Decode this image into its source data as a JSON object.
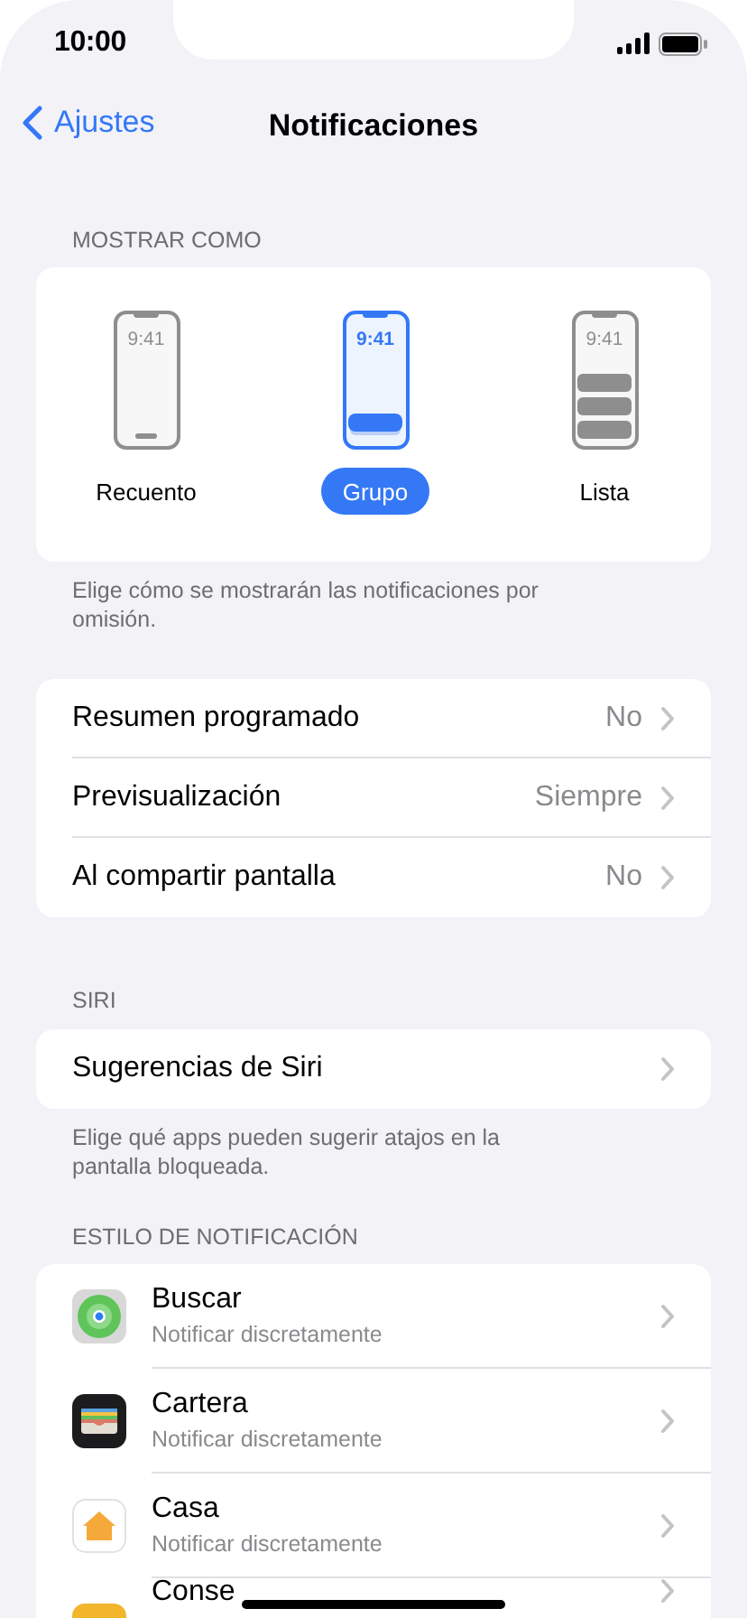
{
  "status_bar": {
    "time": "10:00"
  },
  "nav": {
    "back": "Ajustes",
    "title": "Notificaciones"
  },
  "display_section": {
    "header": "MOSTRAR COMO",
    "options": [
      {
        "label": "Recuento",
        "kind": "count",
        "selected": false,
        "screen_time": "9:41"
      },
      {
        "label": "Grupo",
        "kind": "stack",
        "selected": true,
        "screen_time": "9:41"
      },
      {
        "label": "Lista",
        "kind": "list",
        "selected": false,
        "screen_time": "9:41"
      }
    ],
    "footer": "Elige cómo se mostrarán las notificaciones por omisión."
  },
  "general_rows": [
    {
      "label": "Resumen programado",
      "value": "No"
    },
    {
      "label": "Previsualización",
      "value": "Siempre"
    },
    {
      "label": "Al compartir pantalla",
      "value": "No"
    }
  ],
  "siri_section": {
    "header": "SIRI",
    "rows": [
      {
        "label": "Sugerencias de Siri"
      }
    ],
    "footer": "Elige qué apps pueden sugerir atajos en la pantalla bloqueada."
  },
  "style_section": {
    "header": "ESTILO DE NOTIFICACIÓN",
    "apps": [
      {
        "name": "Buscar",
        "subtitle": "Notificar discretamente",
        "kind": "find"
      },
      {
        "name": "Cartera",
        "subtitle": "Notificar discretamente",
        "kind": "wallet"
      },
      {
        "name": "Casa",
        "subtitle": "Notificar discretamente",
        "kind": "home"
      },
      {
        "name": "Conse",
        "kind": "tips"
      }
    ]
  }
}
